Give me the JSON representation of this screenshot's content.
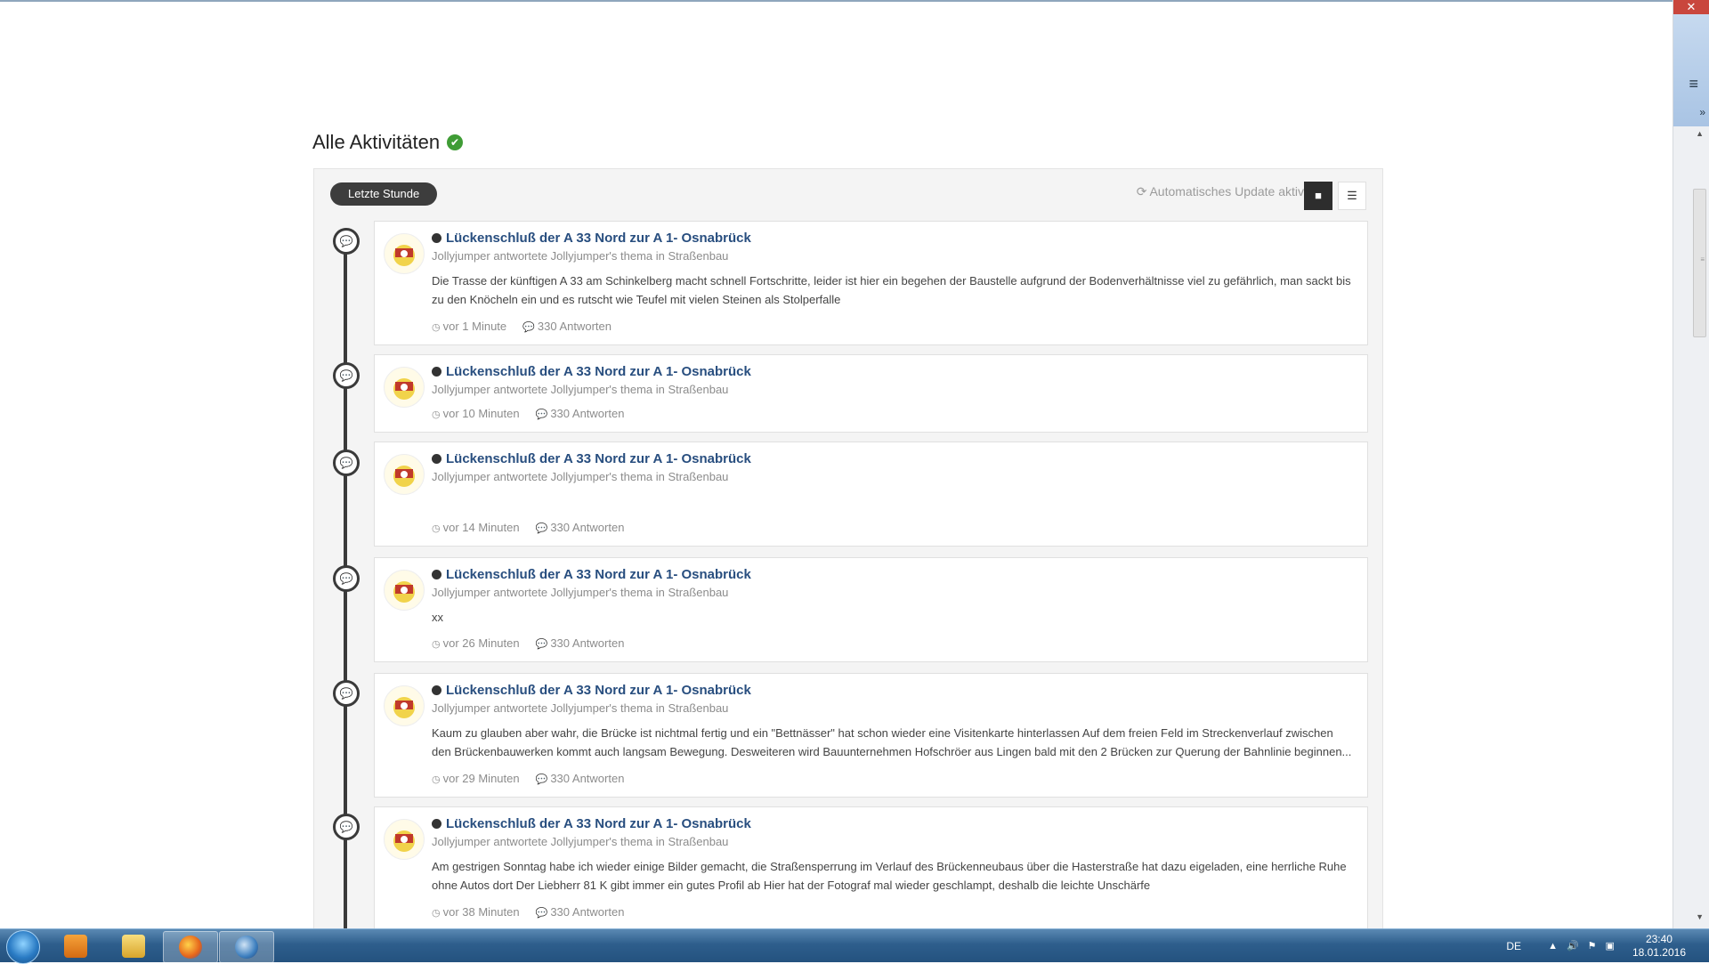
{
  "window": {
    "close_glyph": "✕",
    "menu_glyph": "≡",
    "chevron_glyph": "»"
  },
  "page": {
    "title": "Alle Aktivitäten"
  },
  "stream": {
    "filter_label": "Letzte Stunde",
    "auto_update_label": "Automatisches Update aktiv",
    "items": [
      {
        "title": "Lückenschluß der A 33 Nord zur A 1- Osnabrück",
        "meta": "Jollyjumper antwortete Jollyjumper's thema in Straßenbau",
        "snippet": "Die Trasse der künftigen A 33 am Schinkelberg macht schnell Fortschritte, leider ist hier ein begehen der Baustelle aufgrund der Bodenverhältnisse viel zu gefährlich, man sackt bis zu den Knöcheln ein und es rutscht wie Teufel mit vielen Steinen als Stolperfalle",
        "time": "vor 1 Minute",
        "replies": "330 Antworten"
      },
      {
        "title": "Lückenschluß der A 33 Nord zur A 1- Osnabrück",
        "meta": "Jollyjumper antwortete Jollyjumper's thema in Straßenbau",
        "snippet": "",
        "time": "vor 10 Minuten",
        "replies": "330 Antworten"
      },
      {
        "title": "Lückenschluß der A 33 Nord zur A 1- Osnabrück",
        "meta": "Jollyjumper antwortete Jollyjumper's thema in Straßenbau",
        "snippet": "",
        "time": "vor 14 Minuten",
        "replies": "330 Antworten"
      },
      {
        "title": "Lückenschluß der A 33 Nord zur A 1- Osnabrück",
        "meta": "Jollyjumper antwortete Jollyjumper's thema in Straßenbau",
        "snippet": "xx",
        "time": "vor 26 Minuten",
        "replies": "330 Antworten"
      },
      {
        "title": "Lückenschluß der A 33 Nord zur A 1- Osnabrück",
        "meta": "Jollyjumper antwortete Jollyjumper's thema in Straßenbau",
        "snippet": "Kaum zu glauben aber wahr, die Brücke ist nichtmal fertig und ein \"Bettnässer\" hat schon wieder eine Visitenkarte hinterlassen Auf dem freien Feld im Streckenverlauf zwischen den Brückenbauwerken kommt auch langsam Bewegung. Desweiteren wird Bauunternehmen Hofschröer aus Lingen bald mit den 2 Brücken zur Querung der Bahnlinie beginnen...",
        "time": "vor 29 Minuten",
        "replies": "330 Antworten"
      },
      {
        "title": "Lückenschluß der A 33 Nord zur A 1- Osnabrück",
        "meta": "Jollyjumper antwortete Jollyjumper's thema in Straßenbau",
        "snippet": "Am gestrigen Sonntag habe ich wieder einige Bilder gemacht, die Straßensperrung im Verlauf des Brückenneubaus über die Hasterstraße hat dazu eigeladen, eine herrliche Ruhe ohne Autos dort Der Liebherr 81 K gibt immer ein gutes Profil ab Hier hat der Fotograf mal wieder geschlampt, deshalb die leichte Unschärfe",
        "time": "vor 38 Minuten",
        "replies": "330 Antworten"
      }
    ]
  },
  "taskbar": {
    "language": "DE",
    "time": "23:40",
    "date": "18.01.2016"
  },
  "colors": {
    "link": "#284e7f",
    "success": "#3f9c35",
    "timeline": "#3a3a3a"
  }
}
